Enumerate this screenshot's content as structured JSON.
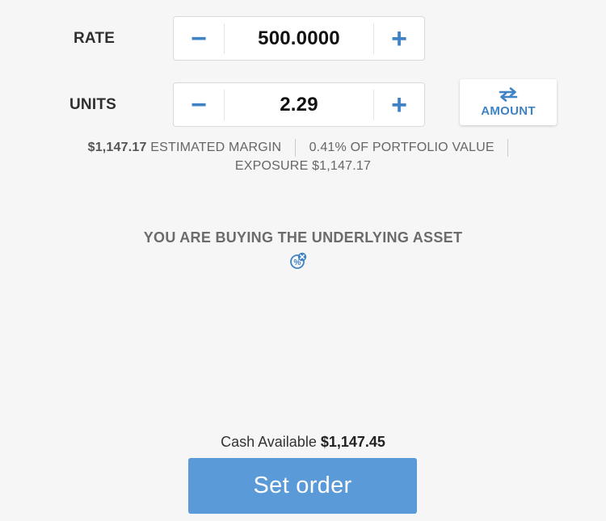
{
  "rate": {
    "label": "RATE",
    "value": "500.0000",
    "decrement_symbol": "−",
    "increment_symbol": "+"
  },
  "units": {
    "label": "UNITS",
    "value": "2.29",
    "decrement_symbol": "−",
    "increment_symbol": "+"
  },
  "toggle": {
    "label": "AMOUNT",
    "icon": "swap-arrows-icon"
  },
  "info": {
    "margin_value": "$1,147.17",
    "margin_label": "ESTIMATED MARGIN",
    "portfolio": "0.41% OF PORTFOLIO VALUE",
    "exposure": "EXPOSURE $1,147.17"
  },
  "underlying": {
    "text": "YOU ARE BUYING THE UNDERLYING ASSET",
    "icon": "no-leverage-percent-icon"
  },
  "cash": {
    "label": "Cash Available",
    "value": "$1,147.45"
  },
  "submit": {
    "label": "Set order"
  },
  "colors": {
    "accent": "#3f83c4",
    "button": "#5b9ad8",
    "background": "#f6f6f6"
  }
}
